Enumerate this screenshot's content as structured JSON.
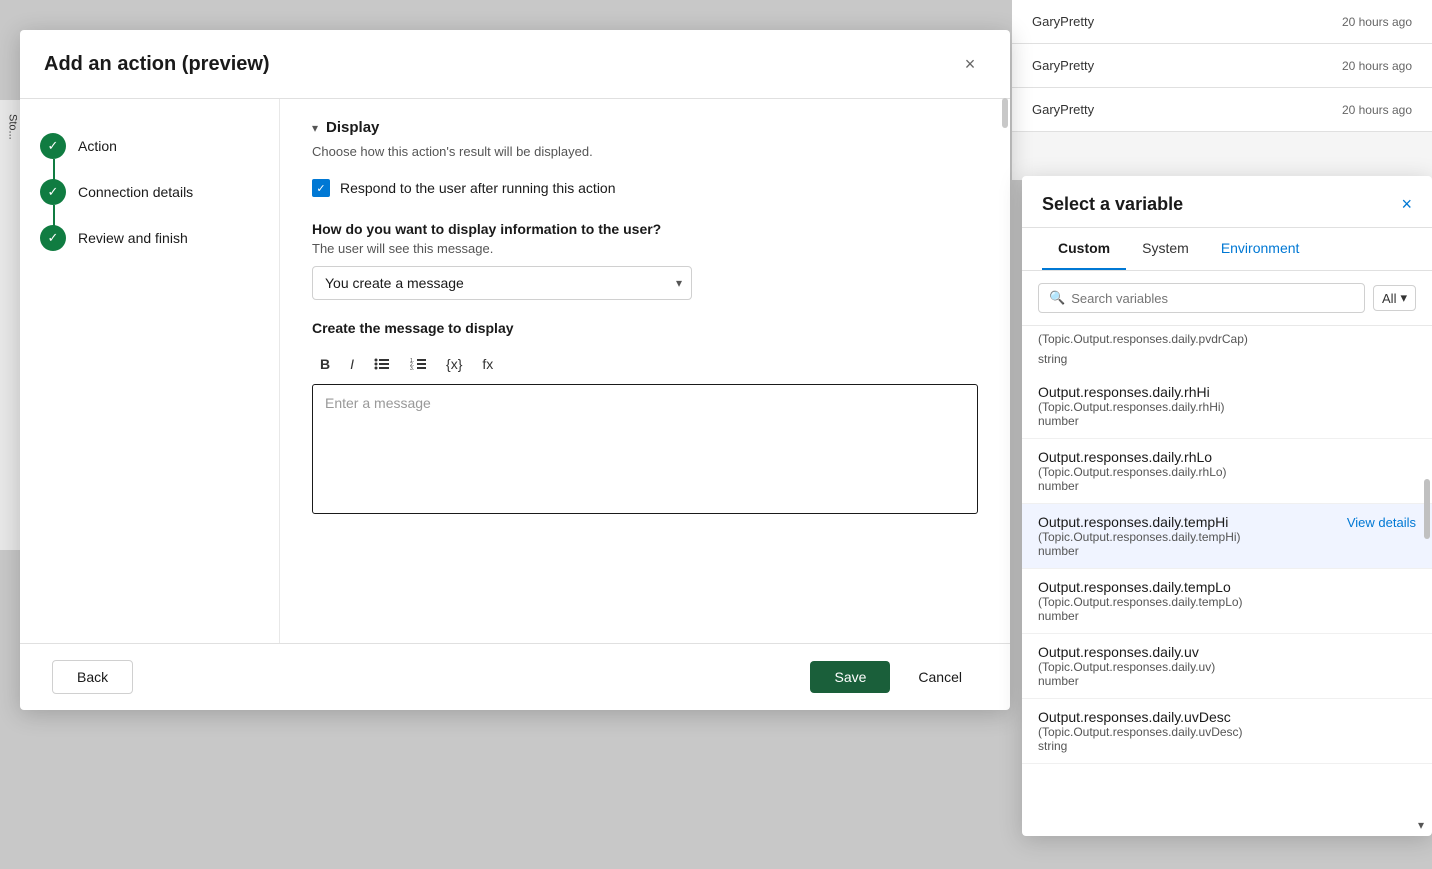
{
  "background": {
    "items": [
      {
        "name": "GaryPretty",
        "time": "20 hours ago"
      },
      {
        "name": "GaryPretty",
        "time": "20 hours ago"
      },
      {
        "name": "GaryPretty",
        "time": "20 hours ago"
      }
    ]
  },
  "modal": {
    "title": "Add an action (preview)",
    "close_label": "×",
    "steps": [
      {
        "label": "Action"
      },
      {
        "label": "Connection details"
      },
      {
        "label": "Review and finish"
      }
    ],
    "display_section": {
      "title": "Display",
      "description": "Choose how this action's result will be displayed.",
      "checkbox_label": "Respond to the user after running this action",
      "question": "How do you want to display information to the user?",
      "sub_label": "The user will see this message.",
      "dropdown_value": "You create a message",
      "create_message_label": "Create the message to display",
      "message_placeholder": "Enter a message"
    },
    "toolbar": {
      "bold": "B",
      "italic": "I",
      "bullet_list": "≡",
      "numbered_list": "≡",
      "variable": "{x}",
      "formula": "fx"
    },
    "footer": {
      "back_label": "Back",
      "save_label": "Save",
      "cancel_label": "Cancel"
    }
  },
  "variable_panel": {
    "title": "Select a variable",
    "close_label": "×",
    "tabs": [
      {
        "label": "Custom",
        "active": true
      },
      {
        "label": "System",
        "active": false
      },
      {
        "label": "Environment",
        "active": false,
        "special": true
      }
    ],
    "search": {
      "placeholder": "Search variables",
      "filter_label": "All"
    },
    "top_path": "(Topic.Output.responses.daily.pvdrCap)",
    "top_type": "string",
    "variables": [
      {
        "name": "Output.responses.daily.rhHi",
        "path": "(Topic.Output.responses.daily.rhHi)",
        "type": "number",
        "highlighted": false,
        "view_details": false
      },
      {
        "name": "Output.responses.daily.rhLo",
        "path": "(Topic.Output.responses.daily.rhLo)",
        "type": "number",
        "highlighted": false,
        "view_details": false
      },
      {
        "name": "Output.responses.daily.tempHi",
        "path": "(Topic.Output.responses.daily.tempHi)",
        "type": "number",
        "highlighted": true,
        "view_details": true,
        "view_details_label": "View details"
      },
      {
        "name": "Output.responses.daily.tempLo",
        "path": "(Topic.Output.responses.daily.tempLo)",
        "type": "number",
        "highlighted": false,
        "view_details": false
      },
      {
        "name": "Output.responses.daily.uv",
        "path": "(Topic.Output.responses.daily.uv)",
        "type": "number",
        "highlighted": false,
        "view_details": false
      },
      {
        "name": "Output.responses.daily.uvDesc",
        "path": "(Topic.Output.responses.daily.uvDesc)",
        "type": "string",
        "highlighted": false,
        "view_details": false
      }
    ]
  }
}
